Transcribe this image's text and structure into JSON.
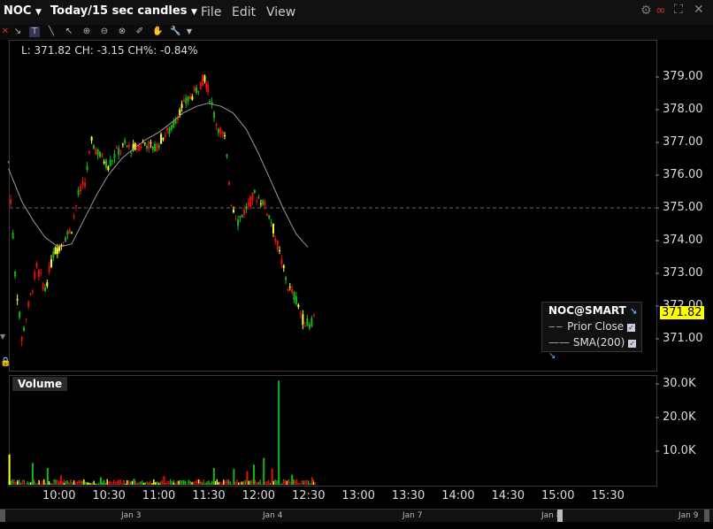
{
  "topbar": {
    "symbol": "NOC",
    "timeframe": "Today/15 sec candles",
    "menus": [
      "File",
      "Edit",
      "View"
    ]
  },
  "readout": "L: 371.82 CH: -3.15 CH%: -0.84%",
  "price_axis": {
    "ticks": [
      "379.00",
      "378.00",
      "377.00",
      "376.00",
      "375.00",
      "374.00",
      "373.00",
      "372.00",
      "371.00"
    ],
    "last_price": "371.82"
  },
  "volume": {
    "title": "Volume",
    "ticks": [
      "30.0K",
      "20.0K",
      "10.0K"
    ]
  },
  "time_axis": {
    "ticks": [
      "10:00",
      "10:30",
      "11:00",
      "11:30",
      "12:00",
      "12:30",
      "13:00",
      "13:30",
      "14:00",
      "14:30",
      "15:00",
      "15:30"
    ],
    "dates": [
      "Jan 3",
      "Jan 4",
      "Jan 7",
      "Jan 8",
      "Jan 9"
    ]
  },
  "legend": {
    "title": "NOC@SMART",
    "items": [
      "Prior Close",
      "SMA(200)"
    ]
  },
  "colors": {
    "up": "#19b319",
    "down": "#e01010",
    "doji": "#ffff33",
    "sma": "#9a9a9a",
    "badge": "#ffff00"
  },
  "chart_data": {
    "type": "candlestick",
    "prior_close": 375.0,
    "ylim": [
      370.4,
      379.8
    ],
    "x_range": [
      "09:30",
      "16:00"
    ],
    "price_path": [
      [
        "09:30",
        376.4
      ],
      [
        "09:34",
        373.0
      ],
      [
        "09:38",
        371.0
      ],
      [
        "09:42",
        372.0
      ],
      [
        "09:47",
        373.2
      ],
      [
        "09:52",
        372.5
      ],
      [
        "09:57",
        373.6
      ],
      [
        "10:03",
        374.0
      ],
      [
        "10:08",
        374.4
      ],
      [
        "10:12",
        375.4
      ],
      [
        "10:16",
        375.8
      ],
      [
        "10:20",
        377.0
      ],
      [
        "10:25",
        376.6
      ],
      [
        "10:30",
        376.3
      ],
      [
        "10:35",
        376.7
      ],
      [
        "10:40",
        376.9
      ],
      [
        "10:45",
        376.8
      ],
      [
        "10:52",
        377.0
      ],
      [
        "10:58",
        376.8
      ],
      [
        "11:03",
        377.2
      ],
      [
        "11:08",
        377.4
      ],
      [
        "11:13",
        378.0
      ],
      [
        "11:18",
        378.3
      ],
      [
        "11:23",
        378.6
      ],
      [
        "11:28",
        379.0
      ],
      [
        "11:31",
        378.4
      ],
      [
        "11:35",
        377.6
      ],
      [
        "11:40",
        377.1
      ],
      [
        "11:44",
        375.2
      ],
      [
        "11:48",
        374.6
      ],
      [
        "11:53",
        375.0
      ],
      [
        "11:58",
        375.4
      ],
      [
        "12:03",
        375.2
      ],
      [
        "12:08",
        374.6
      ],
      [
        "12:13",
        373.6
      ],
      [
        "12:18",
        372.6
      ],
      [
        "12:23",
        372.2
      ],
      [
        "12:27",
        371.6
      ],
      [
        "12:31",
        371.4
      ],
      [
        "12:35",
        371.82
      ]
    ],
    "sma_200": [
      [
        "09:30",
        376.2
      ],
      [
        "09:38",
        375.2
      ],
      [
        "09:45",
        374.6
      ],
      [
        "09:52",
        374.1
      ],
      [
        "10:00",
        373.8
      ],
      [
        "10:08",
        373.9
      ],
      [
        "10:15",
        374.6
      ],
      [
        "10:23",
        375.4
      ],
      [
        "10:30",
        376.0
      ],
      [
        "10:38",
        376.5
      ],
      [
        "10:45",
        376.8
      ],
      [
        "10:53",
        377.1
      ],
      [
        "11:00",
        377.3
      ],
      [
        "11:08",
        377.6
      ],
      [
        "11:15",
        377.9
      ],
      [
        "11:23",
        378.1
      ],
      [
        "11:30",
        378.2
      ],
      [
        "11:38",
        378.1
      ],
      [
        "11:45",
        377.9
      ],
      [
        "11:53",
        377.4
      ],
      [
        "12:00",
        376.7
      ],
      [
        "12:08",
        375.8
      ],
      [
        "12:15",
        375.0
      ],
      [
        "12:23",
        374.2
      ],
      [
        "12:30",
        373.8
      ]
    ],
    "volume_ylim": [
      0,
      32000
    ],
    "volume_spikes": [
      [
        "09:30",
        9000
      ],
      [
        "09:44",
        6500
      ],
      [
        "09:53",
        5000
      ],
      [
        "10:01",
        2800
      ],
      [
        "10:25",
        2200
      ],
      [
        "10:45",
        1800
      ],
      [
        "11:03",
        2600
      ],
      [
        "11:33",
        5000
      ],
      [
        "11:45",
        4800
      ],
      [
        "11:53",
        4000
      ],
      [
        "11:57",
        6000
      ],
      [
        "12:03",
        8000
      ],
      [
        "12:08",
        4800
      ],
      [
        "12:12",
        31000
      ],
      [
        "12:20",
        3000
      ],
      [
        "12:32",
        2200
      ]
    ]
  }
}
